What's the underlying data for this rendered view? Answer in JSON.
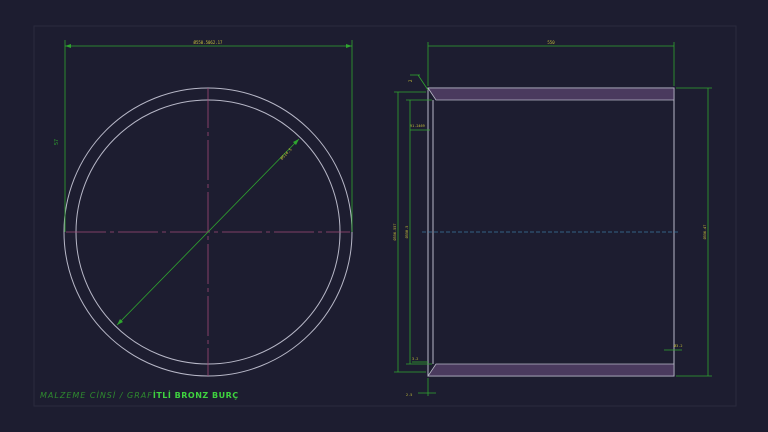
{
  "drawing": {
    "colors": {
      "background": "#1d1d30",
      "outline": "#b8b8c8",
      "dimension": "#2fa52f",
      "dimension_text": "#c8c03a",
      "centerline": "#a04a78",
      "axis": "#3c78a0",
      "section": "#4a3a5e"
    },
    "front_view": {
      "dim_width": "Ø550.5062.17",
      "dim_diagonal": "Ø514.5",
      "dim_side": "57"
    },
    "side_view": {
      "dim_length": "550",
      "dim_chamfer": "2",
      "dim_inner_top": "R1.2469",
      "dim_left_outer": "Ø556.557",
      "dim_left_inner": "Ø550.5",
      "dim_right": "Ø556.47",
      "dim_bottom_left": "3.2",
      "dim_bottom_right": "Ø3.2",
      "dim_bottom_center": "2.5"
    },
    "title": {
      "part1": "MALZEME CİNSİ / GRAF",
      "part2": "İTLİ BRONZ BURÇ"
    }
  }
}
